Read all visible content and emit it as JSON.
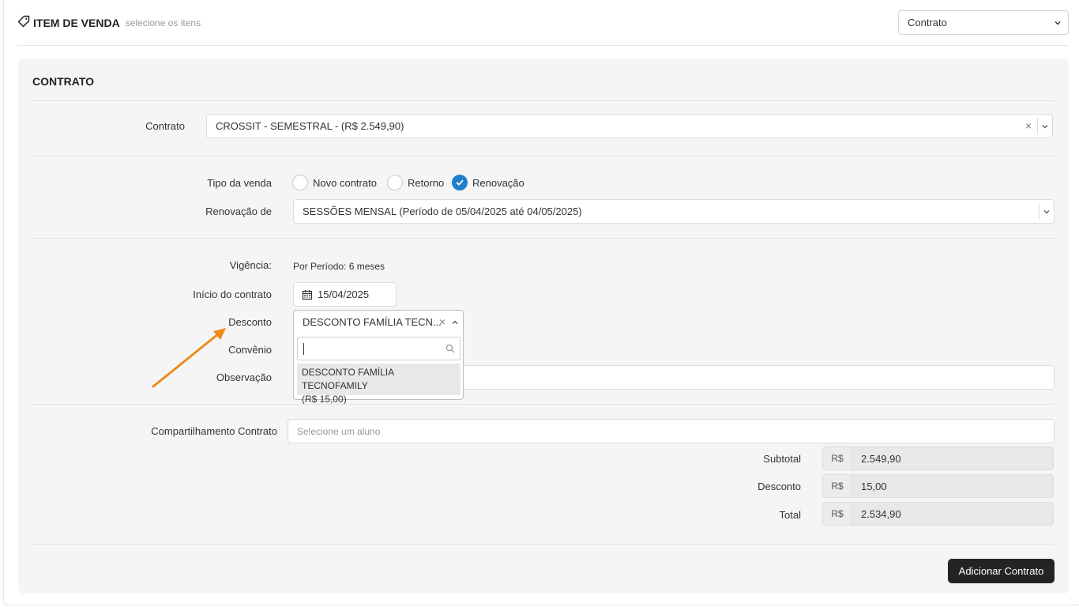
{
  "header": {
    "title": "ITEM DE VENDA",
    "subtitle": "selecione os itens",
    "type_select_value": "Contrato"
  },
  "card": {
    "title": "CONTRATO",
    "contrato_label": "Contrato",
    "contrato_value": "CROSSIT - SEMESTRAL - (R$ 2.549,90)",
    "tipo_venda_label": "Tipo da venda",
    "tipo_venda_options": [
      "Novo contrato",
      "Retorno",
      "Renovação"
    ],
    "tipo_venda_selected": "Renovação",
    "renovacao_label": "Renovação de",
    "renovacao_value": "SESSÕES MENSAL (Período de 05/04/2025 até 04/05/2025)",
    "vigencia_label": "Vigência:",
    "vigencia_value": "Por Período: 6 meses",
    "inicio_label": "Início do contrato",
    "inicio_value": "15/04/2025",
    "desconto_label": "Desconto",
    "desconto_value": "DESCONTO FAMÍLIA TECN...",
    "desconto_option_line1": "DESCONTO FAMÍLIA TECNOFAMILY",
    "desconto_option_line2": "(R$ 15,00)",
    "convenio_label": "Convênio",
    "observacao_label": "Observação",
    "compartilhamento_label": "Compartilhamento Contrato",
    "compartilhamento_placeholder": "Selecione um aluno"
  },
  "totals": {
    "currency": "R$",
    "subtotal_label": "Subtotal",
    "subtotal_value": "2.549,90",
    "desconto_label": "Desconto",
    "desconto_value": "15,00",
    "total_label": "Total",
    "total_value": "2.534,90"
  },
  "actions": {
    "add_label": "Adicionar Contrato"
  },
  "colors": {
    "accent": "#1f7fc8",
    "annotation_arrow": "#f08a1c",
    "button_bg": "#222522"
  },
  "icons": [
    "tag-icon",
    "chevron-down-icon",
    "clear-icon",
    "chevron-up-icon",
    "calendar-icon",
    "search-icon",
    "check-icon",
    "annotation-arrow"
  ]
}
